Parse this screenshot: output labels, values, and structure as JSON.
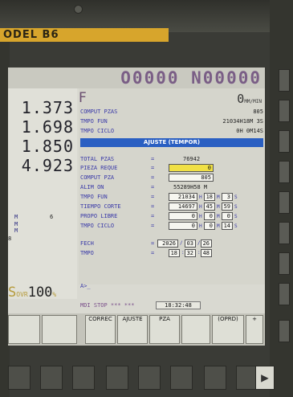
{
  "model": "ODEL B6",
  "program_header": "O0000 N00000",
  "positions": [
    "1.373",
    "1.698",
    "1.850",
    "4.923"
  ],
  "axis_rows": [
    {
      "a": "M",
      "b": "6"
    },
    {
      "a": "M",
      "b": ""
    },
    {
      "a": "M",
      "b": ""
    },
    {
      "a": "8",
      "b": ""
    }
  ],
  "feed": {
    "prefix": "S",
    "ovr": "OVR",
    "value": "100",
    "suffix": "%"
  },
  "panel": {
    "f_label": "F",
    "tool": "0",
    "tool_unit": "MM/MIN",
    "top": [
      {
        "label": "COMPUT PZAS",
        "value": "805"
      },
      {
        "label": "TMPO FUN",
        "value": "21034H18M 3S"
      },
      {
        "label": "TMPO CICLO",
        "value": "0H 0M14S"
      }
    ],
    "title": "AJUSTE (TEMPOR)",
    "items": [
      {
        "label": "TOTAL PZAS",
        "value": "76942"
      },
      {
        "label": "PIEZA REQUE",
        "value": "0"
      },
      {
        "label": "COMPUT PZA",
        "value": "805"
      },
      {
        "label": "ALIM ON",
        "value": "55289H58 M"
      },
      {
        "label": "TMPO FUN",
        "h": "21034",
        "m": "18",
        "s": "3"
      },
      {
        "label": "TIEMPO CORTE",
        "h": "14697",
        "m": "45",
        "s": "59"
      },
      {
        "label": "PROPO LIBRE",
        "h": "0",
        "m": "0",
        "s": "0"
      },
      {
        "label": "TMPO CICLO",
        "h": "0",
        "m": "0",
        "s": "14"
      }
    ],
    "fech_label": "FECH",
    "date": {
      "y": "2026",
      "m": "03",
      "d": "26"
    },
    "tmpo_label": "TMPO",
    "time": {
      "h": "18",
      "m": "32",
      "s": "48"
    },
    "eq": "=",
    "unit_h": "H",
    "unit_m": "M",
    "unit_s": "S"
  },
  "cmd_prompt": "A>_",
  "status": {
    "mode": "MDI STOP *** ***",
    "clock": "18:32:48"
  },
  "softkeys": [
    "",
    "",
    "CORREC",
    "AJUSTE",
    "PZA",
    "",
    "",
    "(OPRD)",
    "+"
  ]
}
